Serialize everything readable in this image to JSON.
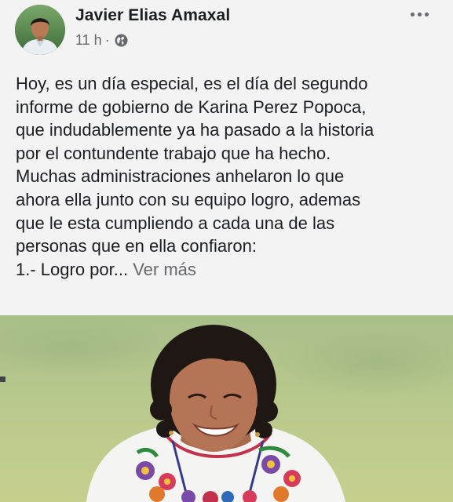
{
  "post": {
    "author": "Javier Elias Amaxal",
    "time": "11 h",
    "separator": "·",
    "privacy_icon": "globe-icon",
    "more_icon": "more-options-icon",
    "text_lines": [
      "Hoy, es un día especial, es el día del segundo",
      "informe de gobierno de Karina Perez Popoca,",
      "que indudablemente ya ha pasado a la historia",
      "por el contundente trabajo que ha hecho.",
      "Muchas administraciones anhelaron lo que",
      "ahora ella junto con su equipo logro, ademas",
      "que le esta cumpliendo a cada una de las",
      "personas que en ella confiaron:",
      "1.- Logro por..."
    ],
    "see_more": "Ver más"
  },
  "colors": {
    "background": "#f3f3f3",
    "text": "#1c1e21",
    "secondary_text": "#65676b"
  }
}
